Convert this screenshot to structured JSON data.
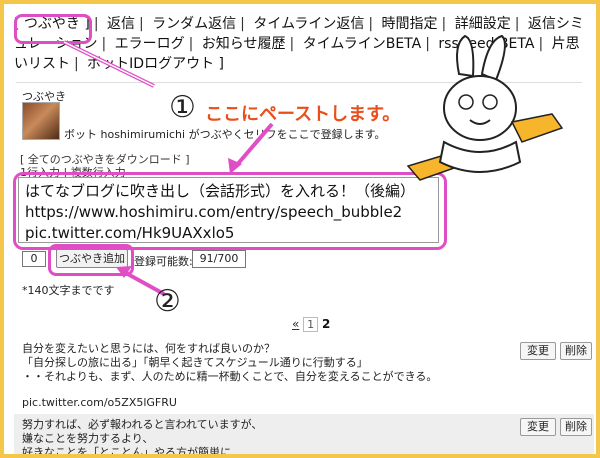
{
  "nav": {
    "items": [
      "[ つぶやき ]",
      "返信",
      "ランダム返信",
      "タイムライン返信",
      "時間指定",
      "詳細設定",
      "返信シミュレーション",
      "エラーログ",
      "お知らせ履歴",
      "タイムラインBETA",
      "rss/feed BETA",
      "片思いリスト",
      "ボットIDログアウト ]"
    ]
  },
  "profile": {
    "title": "つぶやき",
    "description": "ボット hoshimirumichi がつぶやくセリフをここで登録します。"
  },
  "download_link": "[ 全てのつぶやきをダウンロード ]",
  "input_tabs": "1行入力 | 複数行入力",
  "textarea": {
    "value": "はてなブログに吹き出し（会話形式）を入れる！（後編）\nhttps://www.hoshimiru.com/entry/speech_bubble2\npic.twitter.com/Hk9UAXxlo5"
  },
  "counter": "0",
  "add_button": "つぶやき追加",
  "remaining": {
    "label": "登録可能数:",
    "value": "91/700"
  },
  "note": "*140文字までです",
  "pager": {
    "prev": "«",
    "page1": "1",
    "page2": "2"
  },
  "tweets": [
    {
      "text": "自分を変えたいと思うには、何をすれば良いのか？\n「自分探しの旅に出る」「朝早く起きてスケジュール通りに行動する」\n・・それよりも、まず、人のために精一杯動くことで、自分を変えることができる。",
      "link": "pic.twitter.com/o5ZX5lGFRU",
      "change": "変更",
      "delete": "削除"
    },
    {
      "text": "努力すれば、必ず報われると言われていますが、\n嫌なことを努力するより、\n好きなことを「とことん」やる方が簡単に、",
      "change": "変更",
      "delete": "削除"
    }
  ],
  "annotations": {
    "circle1": "①",
    "callout": "ここにペーストします。",
    "circle2": "②"
  },
  "colors": {
    "highlight": "#e04ec5",
    "frame": "#f4c64a",
    "callout": "#e94e1b",
    "mascot_arm": "#f7b52c"
  }
}
